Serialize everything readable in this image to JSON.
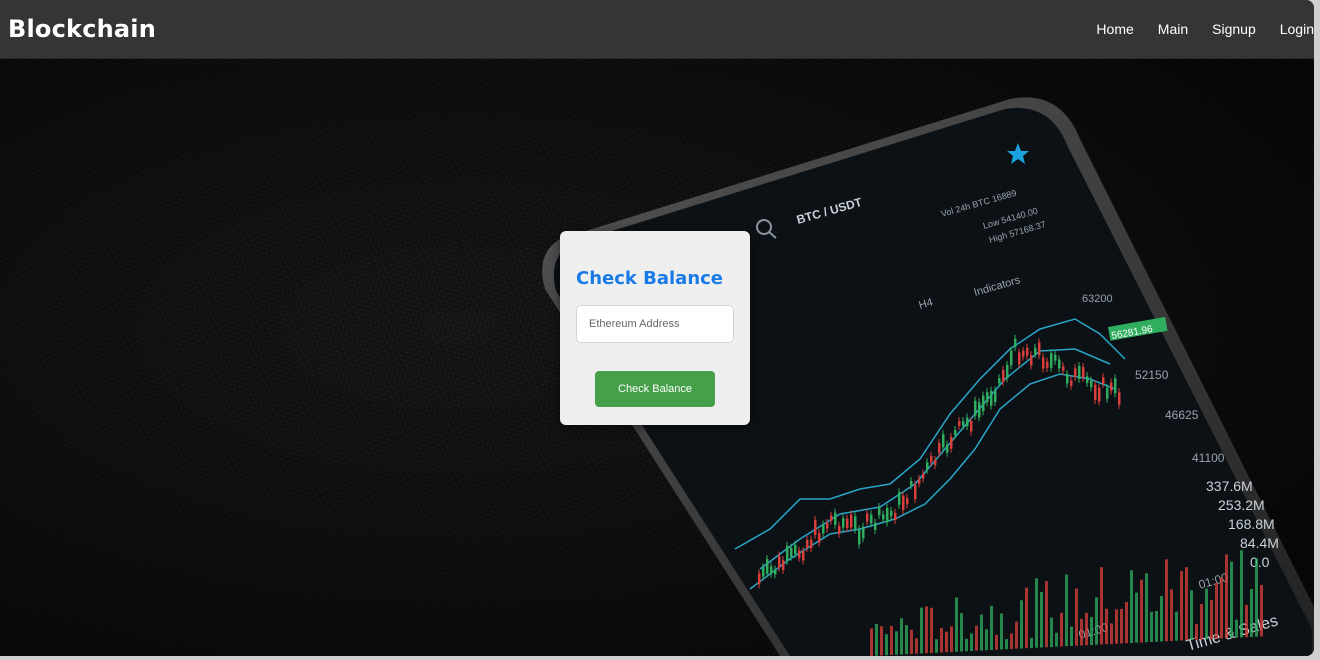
{
  "navbar": {
    "brand": "Blockchain",
    "links": [
      {
        "label": "Home"
      },
      {
        "label": "Main"
      },
      {
        "label": "Signup"
      },
      {
        "label": "Login"
      }
    ]
  },
  "phone_screen": {
    "pair": "BTC / USDT",
    "interval": "H4",
    "indicators": "Indicators",
    "vol_label": "Vol 24h BTC 16889",
    "low_label": "Low 54140.00",
    "high_label": "High 57168.37",
    "price_badge": "56281.96",
    "price_levels": [
      "63200",
      "52150",
      "46625",
      "41100"
    ],
    "volume_levels": [
      "337.6M",
      "253.2M",
      "168.8M",
      "84.4M",
      "0.0"
    ],
    "times": [
      "01:00",
      "01:00"
    ],
    "time_sales": "Time & Sales"
  },
  "balance_card": {
    "title": "Check Balance",
    "input_placeholder": "Ethereum Address",
    "button_label": "Check Balance"
  },
  "colors": {
    "navbar_bg": "#353535",
    "title_blue": "#1a7be6",
    "button_green": "#46a049",
    "candle_green": "#2fae5f",
    "candle_red": "#d9403a",
    "band_teal": "#2aa6c8"
  }
}
